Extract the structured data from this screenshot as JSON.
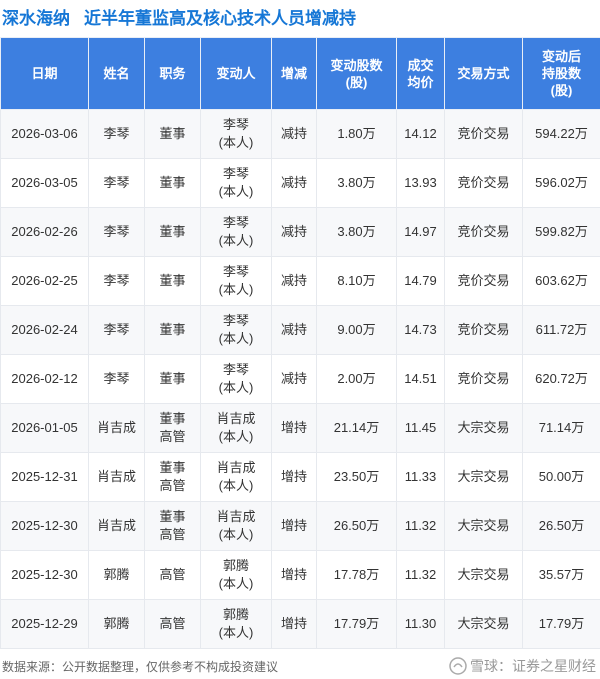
{
  "company": "深水海纳",
  "title": "近半年董监高及核心技术人员增减持",
  "columns": [
    {
      "line1": "日期",
      "line2": "",
      "line3": ""
    },
    {
      "line1": "姓名",
      "line2": "",
      "line3": ""
    },
    {
      "line1": "职务",
      "line2": "",
      "line3": ""
    },
    {
      "line1": "变动人",
      "line2": "",
      "line3": ""
    },
    {
      "line1": "增减",
      "line2": "",
      "line3": ""
    },
    {
      "line1": "变动股数",
      "line2": "(股)",
      "line3": ""
    },
    {
      "line1": "成交",
      "line2": "均价",
      "line3": ""
    },
    {
      "line1": "交易方式",
      "line2": "",
      "line3": ""
    },
    {
      "line1": "变动后",
      "line2": "持股数",
      "line3": "(股)"
    }
  ],
  "rows": [
    {
      "date": "2026-03-06",
      "name": "李琴",
      "role1": "董事",
      "role2": "",
      "changer1": "李琴",
      "changer2": "(本人)",
      "direction": "减持",
      "shares": "1.80万",
      "price": "14.12",
      "method": "竞价交易",
      "after": "594.22万"
    },
    {
      "date": "2026-03-05",
      "name": "李琴",
      "role1": "董事",
      "role2": "",
      "changer1": "李琴",
      "changer2": "(本人)",
      "direction": "减持",
      "shares": "3.80万",
      "price": "13.93",
      "method": "竞价交易",
      "after": "596.02万"
    },
    {
      "date": "2026-02-26",
      "name": "李琴",
      "role1": "董事",
      "role2": "",
      "changer1": "李琴",
      "changer2": "(本人)",
      "direction": "减持",
      "shares": "3.80万",
      "price": "14.97",
      "method": "竞价交易",
      "after": "599.82万"
    },
    {
      "date": "2026-02-25",
      "name": "李琴",
      "role1": "董事",
      "role2": "",
      "changer1": "李琴",
      "changer2": "(本人)",
      "direction": "减持",
      "shares": "8.10万",
      "price": "14.79",
      "method": "竞价交易",
      "after": "603.62万"
    },
    {
      "date": "2026-02-24",
      "name": "李琴",
      "role1": "董事",
      "role2": "",
      "changer1": "李琴",
      "changer2": "(本人)",
      "direction": "减持",
      "shares": "9.00万",
      "price": "14.73",
      "method": "竞价交易",
      "after": "611.72万"
    },
    {
      "date": "2026-02-12",
      "name": "李琴",
      "role1": "董事",
      "role2": "",
      "changer1": "李琴",
      "changer2": "(本人)",
      "direction": "减持",
      "shares": "2.00万",
      "price": "14.51",
      "method": "竞价交易",
      "after": "620.72万"
    },
    {
      "date": "2026-01-05",
      "name": "肖吉成",
      "role1": "董事",
      "role2": "高管",
      "changer1": "肖吉成",
      "changer2": "(本人)",
      "direction": "增持",
      "shares": "21.14万",
      "price": "11.45",
      "method": "大宗交易",
      "after": "71.14万"
    },
    {
      "date": "2025-12-31",
      "name": "肖吉成",
      "role1": "董事",
      "role2": "高管",
      "changer1": "肖吉成",
      "changer2": "(本人)",
      "direction": "增持",
      "shares": "23.50万",
      "price": "11.33",
      "method": "大宗交易",
      "after": "50.00万"
    },
    {
      "date": "2025-12-30",
      "name": "肖吉成",
      "role1": "董事",
      "role2": "高管",
      "changer1": "肖吉成",
      "changer2": "(本人)",
      "direction": "增持",
      "shares": "26.50万",
      "price": "11.32",
      "method": "大宗交易",
      "after": "26.50万"
    },
    {
      "date": "2025-12-30",
      "name": "郭腾",
      "role1": "高管",
      "role2": "",
      "changer1": "郭腾",
      "changer2": "(本人)",
      "direction": "增持",
      "shares": "17.78万",
      "price": "11.32",
      "method": "大宗交易",
      "after": "35.57万"
    },
    {
      "date": "2025-12-29",
      "name": "郭腾",
      "role1": "高管",
      "role2": "",
      "changer1": "郭腾",
      "changer2": "(本人)",
      "direction": "增持",
      "shares": "17.79万",
      "price": "11.30",
      "method": "大宗交易",
      "after": "17.79万"
    }
  ],
  "footer": {
    "source": "数据来源：公开数据整理，仅供参考不构成投资建议",
    "brand": "雪球：证券之星财经",
    "brand_icon": "snowball-icon"
  },
  "watermark_text": "证券之星",
  "colors": {
    "accent": "#1677d6",
    "header_bg": "#3d7fe0",
    "sell": "#13a113",
    "buy": "#e02020"
  }
}
